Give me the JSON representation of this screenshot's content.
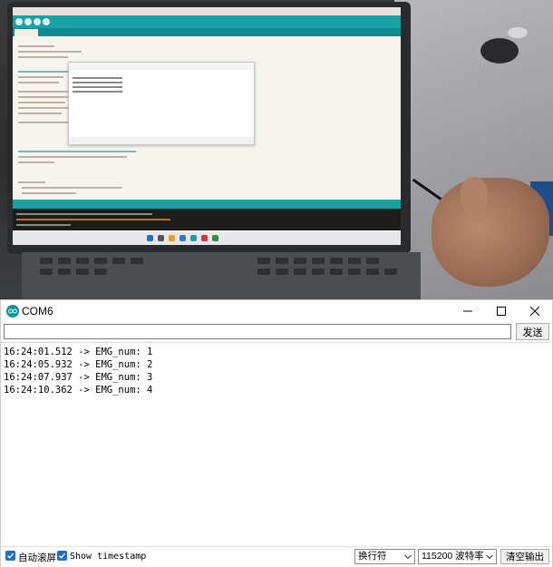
{
  "window": {
    "title": "COM6",
    "app_icon": "arduino-icon",
    "controls": [
      "minimize-icon",
      "maximize-icon",
      "close-icon"
    ]
  },
  "send": {
    "input_value": "",
    "button_label": "发送"
  },
  "output": {
    "lines": [
      "16:24:01.512 -> EMG_num: 1",
      "16:24:05.932 -> EMG_num: 2",
      "16:24:07.937 -> EMG_num: 3",
      "16:24:10.362 -> EMG_num: 4"
    ]
  },
  "bottom": {
    "autoscroll_label": "自动滚屏",
    "autoscroll_checked": true,
    "timestamp_label": "Show timestamp",
    "timestamp_checked": true,
    "line_ending": "换行符",
    "baud_rate": "115200 波特率",
    "clear_label": "清空输出"
  },
  "colors": {
    "accent": "#1a6fd0",
    "arduino_teal": "#00979d"
  }
}
